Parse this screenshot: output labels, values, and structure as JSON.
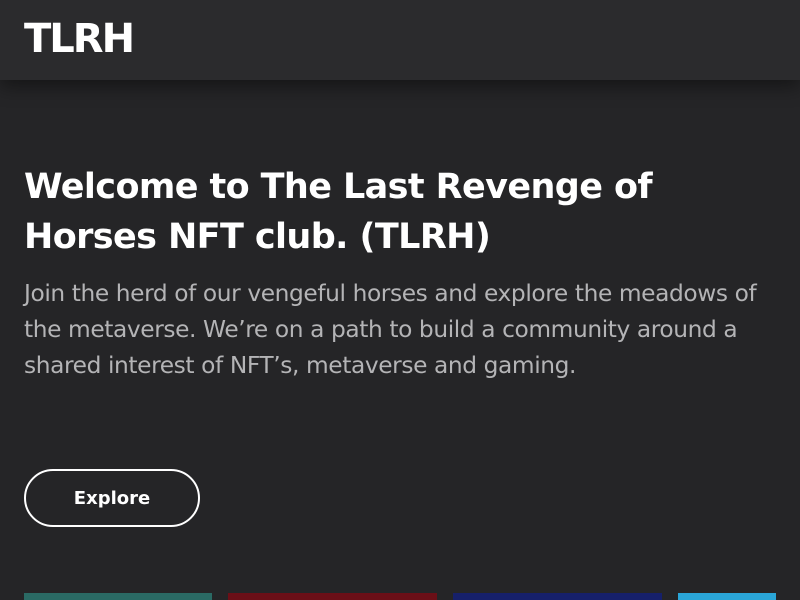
{
  "header": {
    "logo_text": "TLRH"
  },
  "hero": {
    "title": "Welcome to The Last Revenge of Horses NFT club. (TLRH)",
    "subtitle": "Join the herd of our vengeful horses and explore the meadows of the metaverse. We’re on a path to build a community around a shared interest of NFT’s, metaverse and gaming.",
    "explore_label": "Explore"
  },
  "colors": {
    "background": "#252527",
    "header_background": "#2b2b2d",
    "subtitle_text": "#b4b4b6",
    "card_colors": [
      "#2a6a64",
      "#6b0f17",
      "#16206a",
      "#2aa6d8"
    ]
  }
}
